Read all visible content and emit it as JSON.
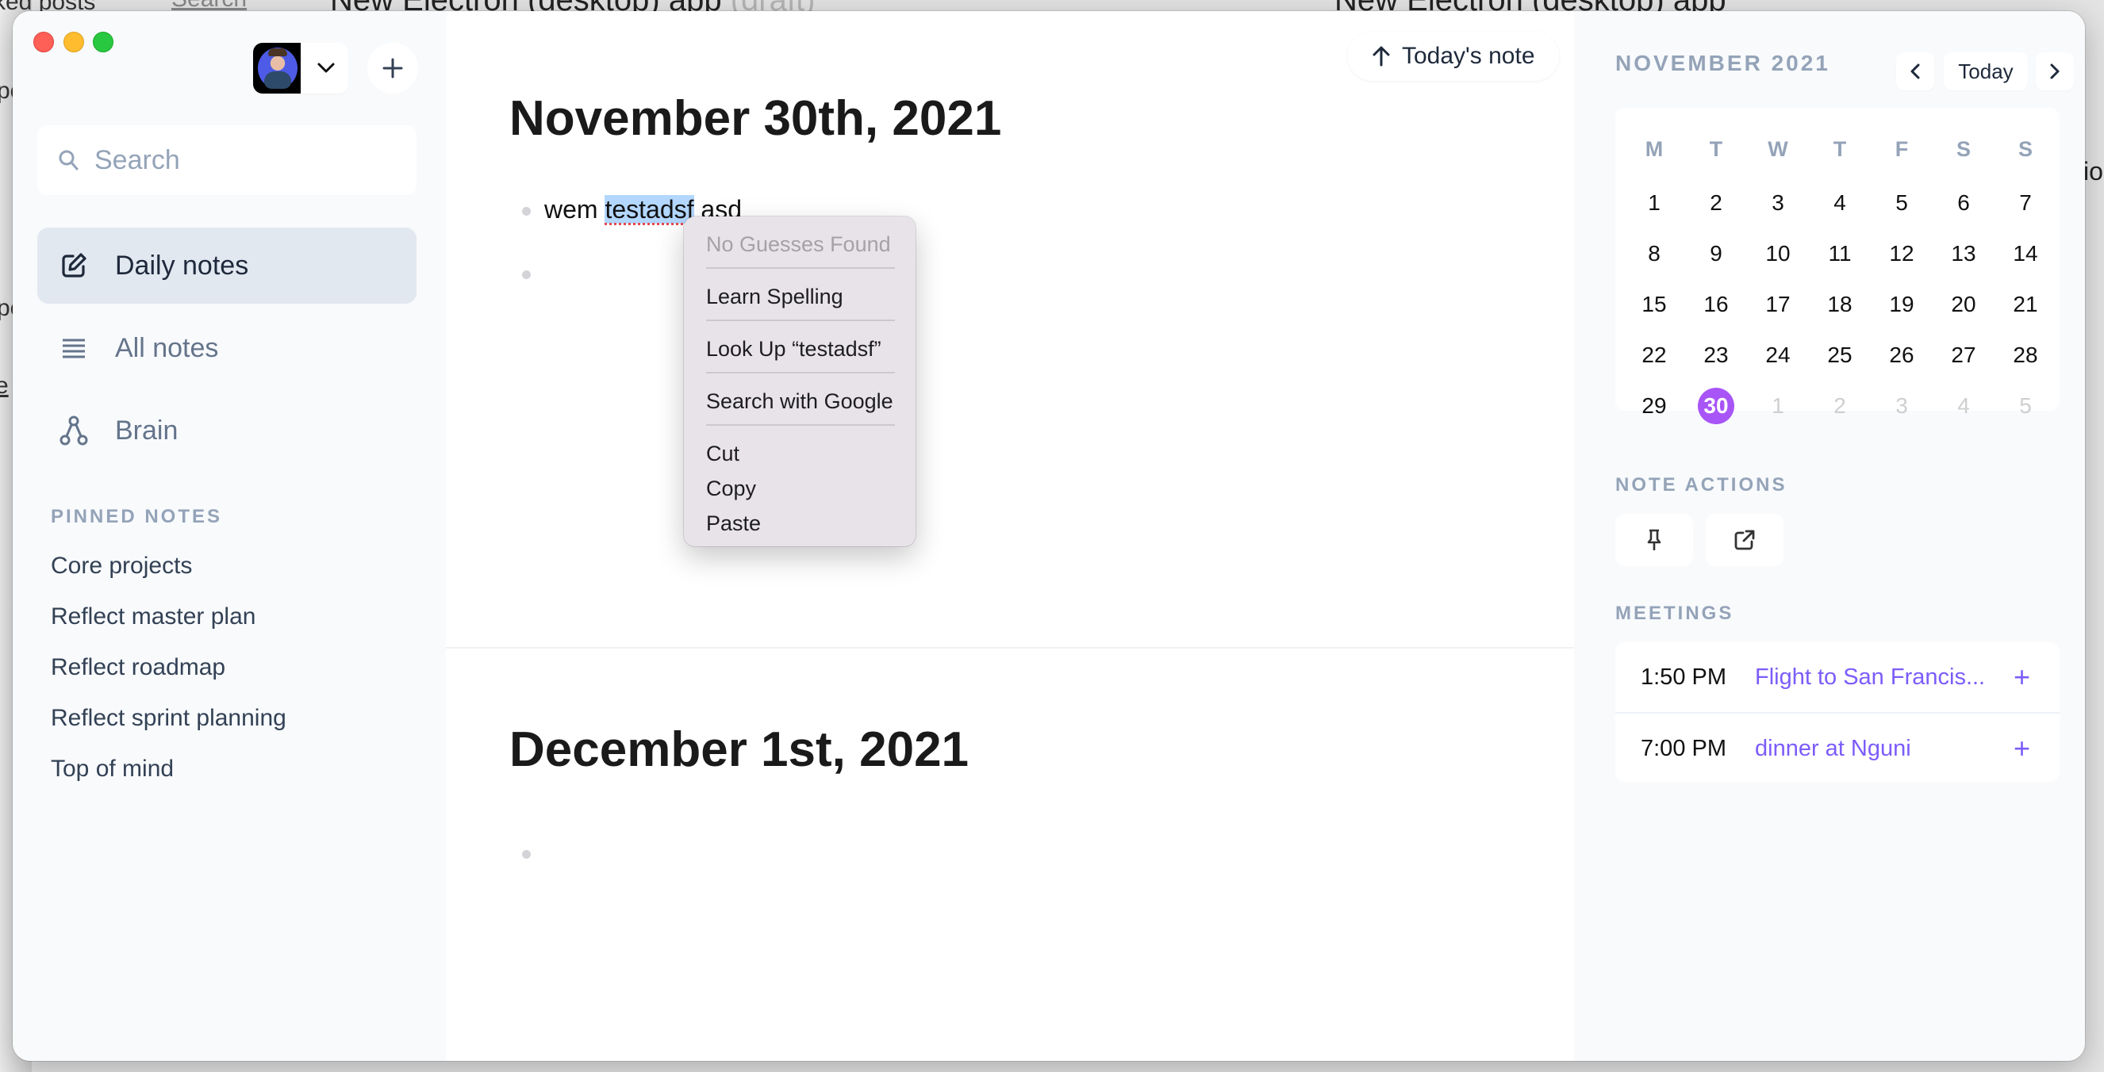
{
  "background": {
    "left_window_fragments": [
      "ked posts",
      "pe",
      "pe",
      "e"
    ],
    "left_window_link": "Search",
    "center_window_title": "New Electron (desktop) app",
    "center_window_title_suffix": "(draft)",
    "right_window_title": "New Electron (desktop) app",
    "right_window_fragment": "ior"
  },
  "window_controls": {
    "close": "close",
    "minimize": "minimize",
    "zoom": "zoom"
  },
  "sidebar": {
    "account_chevron": "chevron-down-icon",
    "new_note_icon": "plus-icon",
    "search": {
      "placeholder": "Search",
      "value": ""
    },
    "nav": [
      {
        "label": "Daily notes",
        "icon": "edit-icon",
        "active": true
      },
      {
        "label": "All notes",
        "icon": "list-icon",
        "active": false
      },
      {
        "label": "Brain",
        "icon": "graph-icon",
        "active": false
      }
    ],
    "pinned_title": "PINNED NOTES",
    "pinned": [
      "Core projects",
      "Reflect master plan",
      "Reflect roadmap",
      "Reflect sprint planning",
      "Top of mind"
    ]
  },
  "main": {
    "todays_note_button": "Today's note",
    "days": [
      {
        "title": "November 30th, 2021",
        "lines": [
          {
            "prefix": "wem ",
            "selected": "testadsf",
            "suffix": " asd"
          },
          {
            "prefix": "",
            "selected": "",
            "suffix": ""
          }
        ]
      },
      {
        "title": "December 1st, 2021",
        "lines": [
          {
            "prefix": "",
            "selected": "",
            "suffix": ""
          }
        ]
      }
    ]
  },
  "context_menu": {
    "items": [
      {
        "label": "No Guesses Found",
        "disabled": true
      },
      {
        "label": "Learn Spelling",
        "disabled": false
      },
      {
        "label": "Look Up “testadsf”",
        "disabled": false
      },
      {
        "label": "Search with Google",
        "disabled": false
      },
      {
        "label": "Cut",
        "disabled": false
      },
      {
        "label": "Copy",
        "disabled": false
      },
      {
        "label": "Paste",
        "disabled": false
      }
    ]
  },
  "right_panel": {
    "month_title": "NOVEMBER 2021",
    "prev_label": "‹",
    "today_label": "Today",
    "next_label": "›",
    "weekdays": [
      "M",
      "T",
      "W",
      "T",
      "F",
      "S",
      "S"
    ],
    "weeks": [
      [
        1,
        2,
        3,
        4,
        5,
        6,
        7
      ],
      [
        8,
        9,
        10,
        11,
        12,
        13,
        14
      ],
      [
        15,
        16,
        17,
        18,
        19,
        20,
        21
      ],
      [
        22,
        23,
        24,
        25,
        26,
        27,
        28
      ],
      [
        29,
        30,
        1,
        2,
        3,
        4,
        5
      ]
    ],
    "today": 30,
    "other_month_cells": [
      [
        4,
        2
      ],
      [
        4,
        3
      ],
      [
        4,
        4
      ],
      [
        4,
        5
      ],
      [
        4,
        6
      ]
    ],
    "today_color": "#a855f7",
    "note_actions_title": "NOTE ACTIONS",
    "note_actions": [
      {
        "icon": "pin-icon",
        "label": "Pin note"
      },
      {
        "icon": "external-link-icon",
        "label": "Open in new window"
      }
    ],
    "meetings_title": "MEETINGS",
    "meetings": [
      {
        "time": "1:50 PM",
        "title": "Flight to San Francis...",
        "add": "+"
      },
      {
        "time": "7:00 PM",
        "title": "dinner at Nguni",
        "add": "+"
      }
    ],
    "accent_color": "#7c5cfa"
  }
}
